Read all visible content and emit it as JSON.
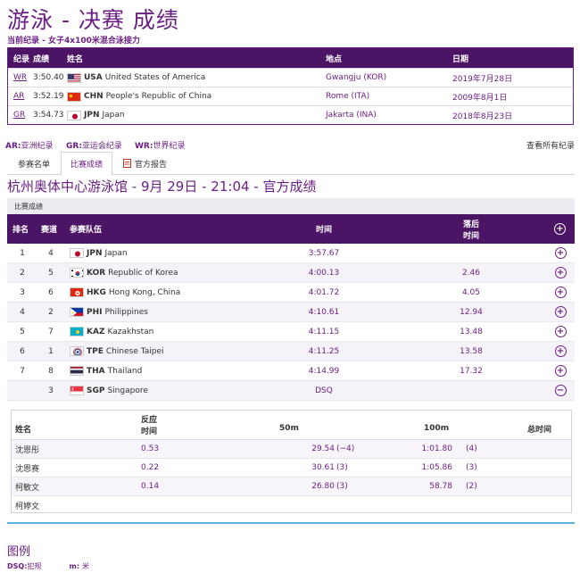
{
  "page": {
    "title": "游泳 - 决赛 成绩",
    "subtitle": "当前纪录 - 女子4x100米混合泳接力"
  },
  "records": {
    "headers": [
      "纪录",
      "成绩",
      "姓名",
      "地点",
      "日期"
    ],
    "rows": [
      {
        "code": "WR",
        "time": "3:50.40",
        "flag": "usa",
        "cc": "USA",
        "name": "United States of America",
        "location": "Gwangju (KOR)",
        "date": "2019年7月28日"
      },
      {
        "code": "AR",
        "time": "3:52.19",
        "flag": "chn",
        "cc": "CHN",
        "name": "People's Republic of China",
        "location": "Rome (ITA)",
        "date": "2009年8月1日"
      },
      {
        "code": "GR",
        "time": "3:54.73",
        "flag": "jpn",
        "cc": "JPN",
        "name": "Japan",
        "location": "Jakarta (INA)",
        "date": "2018年8月23日"
      }
    ]
  },
  "legend_bar": {
    "ar_code": "AR:",
    "ar_label": "亚洲纪录",
    "gr_code": "GR:",
    "gr_label": "亚运会纪录",
    "wr_code": "WR:",
    "wr_label": "世界纪录",
    "view_all": "查看所有纪录"
  },
  "tabs": [
    {
      "label": "参赛名单"
    },
    {
      "label": "比赛成绩"
    },
    {
      "label": "官方报告"
    }
  ],
  "venue": "杭州奥体中心游泳馆 - 9月 29日 - 21:04 - 官方成绩",
  "results_label": "比赛成绩",
  "results_header": {
    "rank": "排名",
    "lane": "赛道",
    "team": "参赛队伍",
    "time": "时间",
    "behind_line1": "落后",
    "behind_line2": "时间"
  },
  "results": [
    {
      "rank": "1",
      "lane": "4",
      "flag": "jpn",
      "cc": "JPN",
      "name": "Japan",
      "time": "3:57.67",
      "behind": "",
      "btn": "+"
    },
    {
      "rank": "2",
      "lane": "5",
      "flag": "kor",
      "cc": "KOR",
      "name": "Republic of Korea",
      "time": "4:00.13",
      "behind": "2.46",
      "btn": "+"
    },
    {
      "rank": "3",
      "lane": "6",
      "flag": "hkg",
      "cc": "HKG",
      "name": "Hong Kong, China",
      "time": "4:01.72",
      "behind": "4.05",
      "btn": "+"
    },
    {
      "rank": "4",
      "lane": "2",
      "flag": "phi",
      "cc": "PHI",
      "name": "Philippines",
      "time": "4:10.61",
      "behind": "12.94",
      "btn": "+"
    },
    {
      "rank": "5",
      "lane": "7",
      "flag": "kaz",
      "cc": "KAZ",
      "name": "Kazakhstan",
      "time": "4:11.15",
      "behind": "13.48",
      "btn": "+"
    },
    {
      "rank": "6",
      "lane": "1",
      "flag": "tpe",
      "cc": "TPE",
      "name": "Chinese Taipei",
      "time": "4:11.25",
      "behind": "13.58",
      "btn": "+"
    },
    {
      "rank": "7",
      "lane": "8",
      "flag": "tha",
      "cc": "THA",
      "name": "Thailand",
      "time": "4:14.99",
      "behind": "17.32",
      "btn": "+"
    },
    {
      "rank": "",
      "lane": "3",
      "flag": "sgp",
      "cc": "SGP",
      "name": "Singapore",
      "time": "DSQ",
      "behind": "",
      "btn": "−"
    }
  ],
  "detail": {
    "header": {
      "name": "姓名",
      "react_line1": "反应",
      "react_line2": "时间",
      "m50": "50m",
      "m100": "100m",
      "total": "总时间"
    },
    "rows": [
      {
        "name": "沈恩彤",
        "react": "0.53",
        "m50": "29.54",
        "m50_split": "(−4)",
        "m100": "1:01.80",
        "m100_split": "(4)"
      },
      {
        "name": "沈恩赛",
        "react": "0.22",
        "m50": "30.61",
        "m50_split": "(3)",
        "m100": "1:05.86",
        "m100_split": "(3)"
      },
      {
        "name": "柯敏文",
        "react": "0.14",
        "m50": "26.80",
        "m50_split": "(3)",
        "m100": "58.78",
        "m100_split": "(2)"
      },
      {
        "name": "柯婷文",
        "react": "",
        "m50": "",
        "m50_split": "",
        "m100": "",
        "m100_split": ""
      }
    ]
  },
  "legend": {
    "title": "图例",
    "dsq_code": "DSQ:",
    "dsq_label": "犯规",
    "m_code": "m:",
    "m_label": "米"
  },
  "colors": {
    "accent": "#6b1f83",
    "header_bg": "#4b1464",
    "divider": "#5bb3e0"
  }
}
